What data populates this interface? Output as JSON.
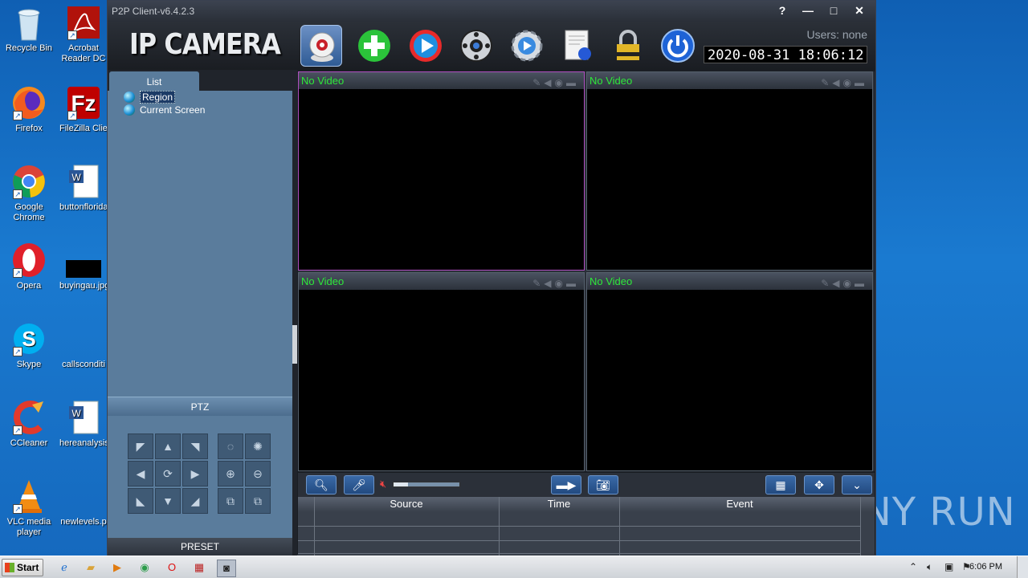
{
  "desktop": {
    "icons_left": [
      {
        "label": "Recycle Bin",
        "icon": "recycle-bin-icon"
      },
      {
        "label": "Firefox",
        "icon": "firefox-icon"
      },
      {
        "label": "Google Chrome",
        "icon": "chrome-icon"
      },
      {
        "label": "Opera",
        "icon": "opera-icon"
      },
      {
        "label": "Skype",
        "icon": "skype-icon"
      },
      {
        "label": "CCleaner",
        "icon": "ccleaner-icon"
      },
      {
        "label": "VLC media player",
        "icon": "vlc-icon"
      }
    ],
    "icons_right": [
      {
        "label": "Acrobat Reader DC",
        "icon": "acrobat-icon"
      },
      {
        "label": "FileZilla Client",
        "icon": "filezilla-icon"
      },
      {
        "label": "buttonflorida.rtf",
        "icon": "word-doc-icon"
      },
      {
        "label": "buyingau.jpg",
        "icon": "image-file-icon"
      },
      {
        "label": "callsconditi",
        "icon": "file-icon"
      },
      {
        "label": "hereanalysis",
        "icon": "word-doc-icon"
      },
      {
        "label": "newlevels.p",
        "icon": "file-icon"
      }
    ],
    "watermark": "ANY RUN"
  },
  "window": {
    "title": "P2P Client-v6.4.2.3",
    "controls": {
      "help": "?",
      "minimize": "—",
      "maximize": "□",
      "close": "✕"
    },
    "brand": "IP CAMERA",
    "users_label": "Users: none",
    "datetime": "2020-08-31  18:06:12",
    "toolbar": [
      "camera-icon",
      "add-icon",
      "playback-icon",
      "ptz-wheel-icon",
      "settings-gear-icon",
      "log-icon",
      "lock-icon",
      "power-icon"
    ]
  },
  "left_panel": {
    "tab_label": "List",
    "tree": [
      {
        "label": "Region",
        "selected": true
      },
      {
        "label": "Current Screen",
        "selected": false
      }
    ],
    "ptz_label": "PTZ",
    "preset_label": "PRESET"
  },
  "video": {
    "cells": [
      {
        "label": "No Video",
        "selected": true
      },
      {
        "label": "No Video",
        "selected": false
      },
      {
        "label": "No Video",
        "selected": false
      },
      {
        "label": "No Video",
        "selected": false
      }
    ]
  },
  "controls": {
    "volume_level": 0.22
  },
  "events": {
    "columns": [
      "Source",
      "Time",
      "Event"
    ]
  },
  "taskbar": {
    "start_label": "Start",
    "time": "6:06 PM"
  }
}
